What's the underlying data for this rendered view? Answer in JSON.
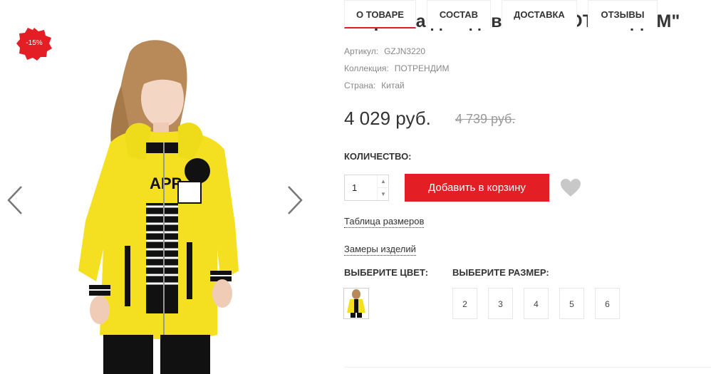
{
  "gallery": {
    "discount_badge": "-15%",
    "prev_icon": "chevron-left-icon",
    "next_icon": "chevron-right-icon",
    "badge_color": "#e31e24"
  },
  "product": {
    "title": "ветровка для девочек \"ПОТРЕНДИМ\"",
    "article_label": "Артикул:",
    "article_value": "GZJN3220",
    "collection_label": "Коллекция:",
    "collection_value": "ПОТРЕНДИМ",
    "country_label": "Страна:",
    "country_value": "Китай",
    "price": "4 029 руб.",
    "old_price": "4 739 руб."
  },
  "purchase": {
    "quantity_label": "КОЛИЧЕСТВО:",
    "quantity_value": "1",
    "add_to_cart": "Добавить в корзину",
    "favorite_icon": "heart-icon",
    "accent_color": "#e31e24"
  },
  "links": {
    "size_table": "Таблица размеров",
    "measurements": "Замеры изделий"
  },
  "options": {
    "color_label": "ВЫБЕРИТЕ ЦВЕТ:",
    "size_label": "ВЫБЕРИТЕ РАЗМЕР:",
    "sizes": [
      "2",
      "3",
      "4",
      "5",
      "6"
    ]
  },
  "tabs": [
    {
      "label": "О ТОВАРЕ"
    },
    {
      "label": "СОСТАВ"
    },
    {
      "label": "ДОСТАВКА"
    },
    {
      "label": "ОТЗЫВЫ"
    }
  ]
}
